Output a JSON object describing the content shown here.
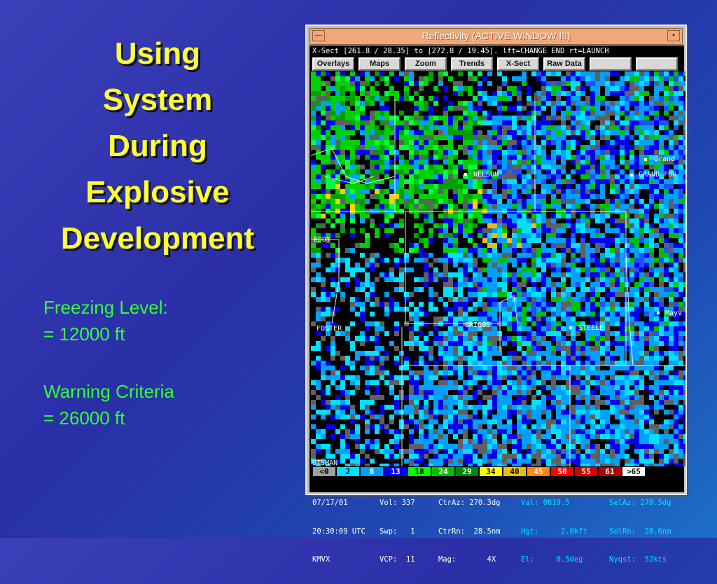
{
  "slide": {
    "title_lines": [
      "Using",
      "System",
      "During",
      "Explosive",
      "Development"
    ],
    "freezing_label": "Freezing Level:",
    "freezing_value": "= 12000 ft",
    "warning_label": "Warning Criteria",
    "warning_value": "=  26000 ft"
  },
  "window": {
    "title": "Reflectivity (ACTIVE WINDOW !!!)",
    "minimize_glyph": "—",
    "maximize_glyph": "▪",
    "xsect_line": "X-Sect  [261.8 /  28.35] to [272.8 /  19.45].  lft=CHANGE END     rt=LAUNCH",
    "buttons": [
      "Overlays",
      "Maps",
      "Zoom",
      "Trends",
      "X-Sect",
      "Raw Data",
      "",
      ""
    ],
    "map_labels": [
      "NELSON",
      "Grand",
      "GRAND_FOR",
      "EDDY",
      "GRIGGS",
      "STEELE",
      "FOSTER",
      "Mayv",
      "UTSMAN"
    ],
    "scale": [
      {
        "label": "<0",
        "bg": "#a0a0a0",
        "fg": "#000000"
      },
      {
        "label": "2",
        "bg": "#00e0ff",
        "fg": "#000000"
      },
      {
        "label": "8",
        "bg": "#00a0ff",
        "fg": "#ffffff"
      },
      {
        "label": "13",
        "bg": "#0000ff",
        "fg": "#ffffff"
      },
      {
        "label": "18",
        "bg": "#00ff00",
        "fg": "#000000"
      },
      {
        "label": "24",
        "bg": "#00c000",
        "fg": "#ffffff"
      },
      {
        "label": "29",
        "bg": "#008800",
        "fg": "#ffffff"
      },
      {
        "label": "34",
        "bg": "#ffff00",
        "fg": "#000000"
      },
      {
        "label": "40",
        "bg": "#e8c000",
        "fg": "#000000"
      },
      {
        "label": "45",
        "bg": "#ff8800",
        "fg": "#ffffff"
      },
      {
        "label": "50",
        "bg": "#ff0000",
        "fg": "#ffffff"
      },
      {
        "label": "55",
        "bg": "#d00000",
        "fg": "#ffffff"
      },
      {
        "label": "61",
        "bg": "#b00000",
        "fg": "#ffffff"
      },
      {
        "label": ">65",
        "bg": "#ffffff",
        "fg": "#000000"
      }
    ],
    "readout": {
      "col1": [
        "07/17/01",
        "20:30:09 UTC",
        "KMVX"
      ],
      "col2": [
        "Vol: 337",
        "Swp:   1",
        "VCP:  11"
      ],
      "col3": [
        "CtrAz: 270.3dg",
        "CtrRn:  28.5nm",
        "Mag:       4X"
      ],
      "col4": [
        "Val: 0019.5",
        "Hgt:     2.0kft",
        "El:     0.5deg"
      ],
      "col5": [
        "SelAz: 270.5dg",
        "SelRn:  28.6nm",
        "Nyqst:  52kts"
      ],
      "col4_color": "#00e0ff",
      "col5_color": "#00e0ff"
    }
  },
  "colors": {
    "title_yellow": "#ffff33",
    "info_green": "#33ff33"
  }
}
